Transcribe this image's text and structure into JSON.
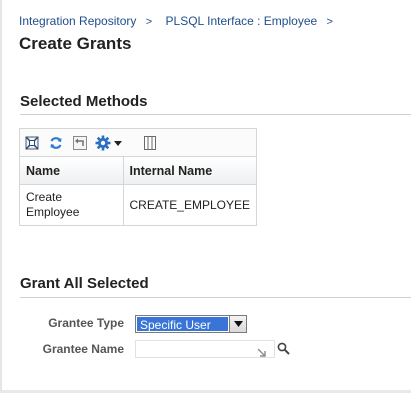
{
  "breadcrumb": [
    {
      "label": "Integration Repository",
      "sep": ">"
    },
    {
      "label": "PLSQL Interface : Employee",
      "sep": ">"
    }
  ],
  "page_title": "Create Grants",
  "selected_methods": {
    "title": "Selected Methods",
    "toolbar_icons": [
      "detach-icon",
      "refresh-icon",
      "reset-icon",
      "settings-icon",
      "columns-icon"
    ],
    "columns": [
      "Name",
      "Internal Name"
    ],
    "rows": [
      {
        "name": "Create Employee",
        "internal_name": "CREATE_EMPLOYEE"
      }
    ]
  },
  "grant_all": {
    "title": "Grant All Selected",
    "grantee_type_label": "Grantee Type",
    "grantee_type_value": "Specific User",
    "grantee_name_label": "Grantee Name",
    "grantee_name_value": ""
  },
  "colors": {
    "link": "#1f4e8c",
    "select_highlight": "#3875d7",
    "settings_icon": "#2a6fc0"
  }
}
